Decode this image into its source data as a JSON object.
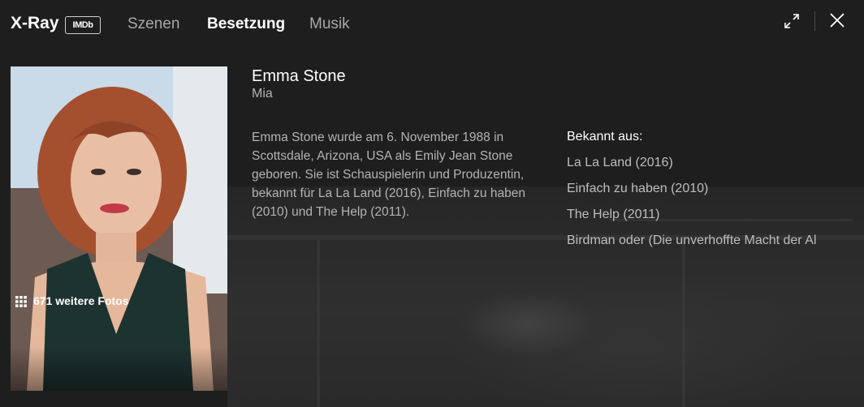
{
  "header": {
    "brand": "X-Ray",
    "badge": "IMDb",
    "tabs": [
      {
        "label": "Szenen",
        "active": false
      },
      {
        "label": "Besetzung",
        "active": true
      },
      {
        "label": "Musik",
        "active": false
      }
    ],
    "icons": [
      "expand-icon",
      "close-icon"
    ]
  },
  "photo": {
    "more_photos_label": "671 weitere Fotos",
    "icon": "grid-icon"
  },
  "actor": {
    "name": "Emma Stone",
    "role": "Mia",
    "bio": "Emma Stone wurde am 6. November 1988 in Scottsdale, Arizona, USA als Emily Jean Stone geboren. Sie ist Schauspielerin und Produzentin, bekannt für La La Land (2016), Einfach zu haben (2010) und The Help (2011)."
  },
  "known_for": {
    "title": "Bekannt aus:",
    "items": [
      "La La Land (2016)",
      "Einfach zu haben (2010)",
      "The Help (2011)",
      "Birdman oder (Die unverhoffte Macht der Al"
    ]
  },
  "colors": {
    "background": "#1e1e1e",
    "text_primary": "#ffffff",
    "text_secondary": "#b3b3b3"
  }
}
